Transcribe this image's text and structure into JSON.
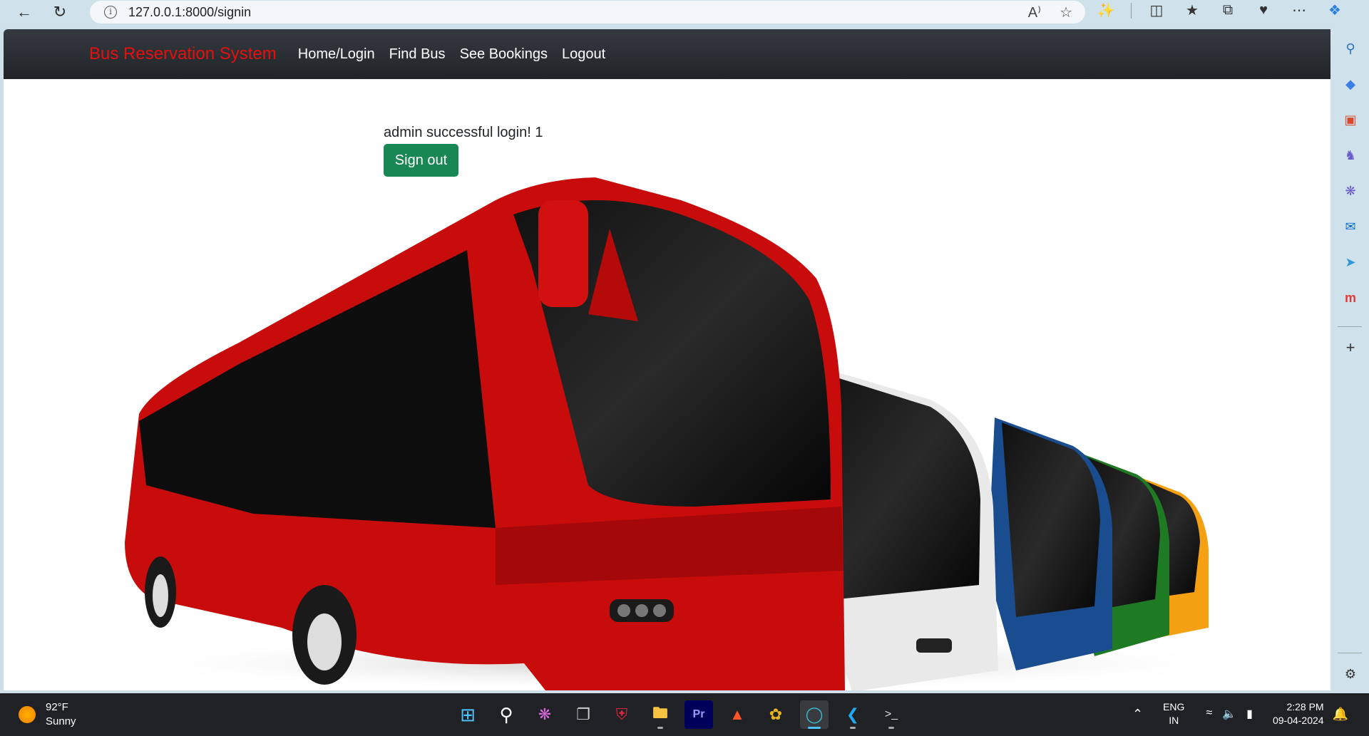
{
  "browser": {
    "url": "127.0.0.1:8000/signin"
  },
  "navbar": {
    "brand": "Bus Reservation System",
    "links": [
      "Home/Login",
      "Find Bus",
      "See Bookings",
      "Logout"
    ]
  },
  "main": {
    "message": "admin successful login! 1",
    "signout_label": "Sign out"
  },
  "colors": {
    "brand": "#e60f0f",
    "signout": "#198754",
    "navbar": "#212529"
  },
  "taskbar": {
    "weather_temp": "92°F",
    "weather_desc": "Sunny",
    "lang_1": "ENG",
    "lang_2": "IN",
    "time": "2:28 PM",
    "date": "09-04-2024"
  }
}
